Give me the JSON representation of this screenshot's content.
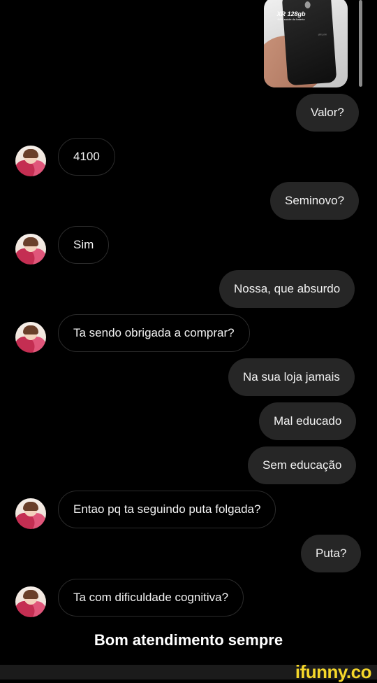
{
  "shared_image": {
    "caption_title": "XR 128gb",
    "caption_subtitle": "84% saúde da bateria",
    "phone_brand": "iPhone"
  },
  "messages": [
    {
      "side": "sent",
      "text": "Valor?"
    },
    {
      "side": "received",
      "text": "4100"
    },
    {
      "side": "sent",
      "text": "Seminovo?"
    },
    {
      "side": "received",
      "text": "Sim"
    },
    {
      "side": "sent",
      "text": "Nossa, que absurdo"
    },
    {
      "side": "received",
      "text": "Ta sendo obrigada a comprar?"
    },
    {
      "side": "sent",
      "text": "Na sua loja jamais"
    },
    {
      "side": "sent",
      "text": "Mal educado"
    },
    {
      "side": "sent",
      "text": "Sem educação"
    },
    {
      "side": "received",
      "text": "Entao pq ta seguindo puta folgada?"
    },
    {
      "side": "sent",
      "text": "Puta?"
    },
    {
      "side": "received",
      "text": "Ta com dificuldade cognitiva?"
    }
  ],
  "caption": "Bom atendimento sempre",
  "watermark": "ifunny.co",
  "colors": {
    "background": "#000000",
    "sent_bubble": "#262626",
    "received_border": "#2b2b2b",
    "watermark": "#f5d72a"
  }
}
